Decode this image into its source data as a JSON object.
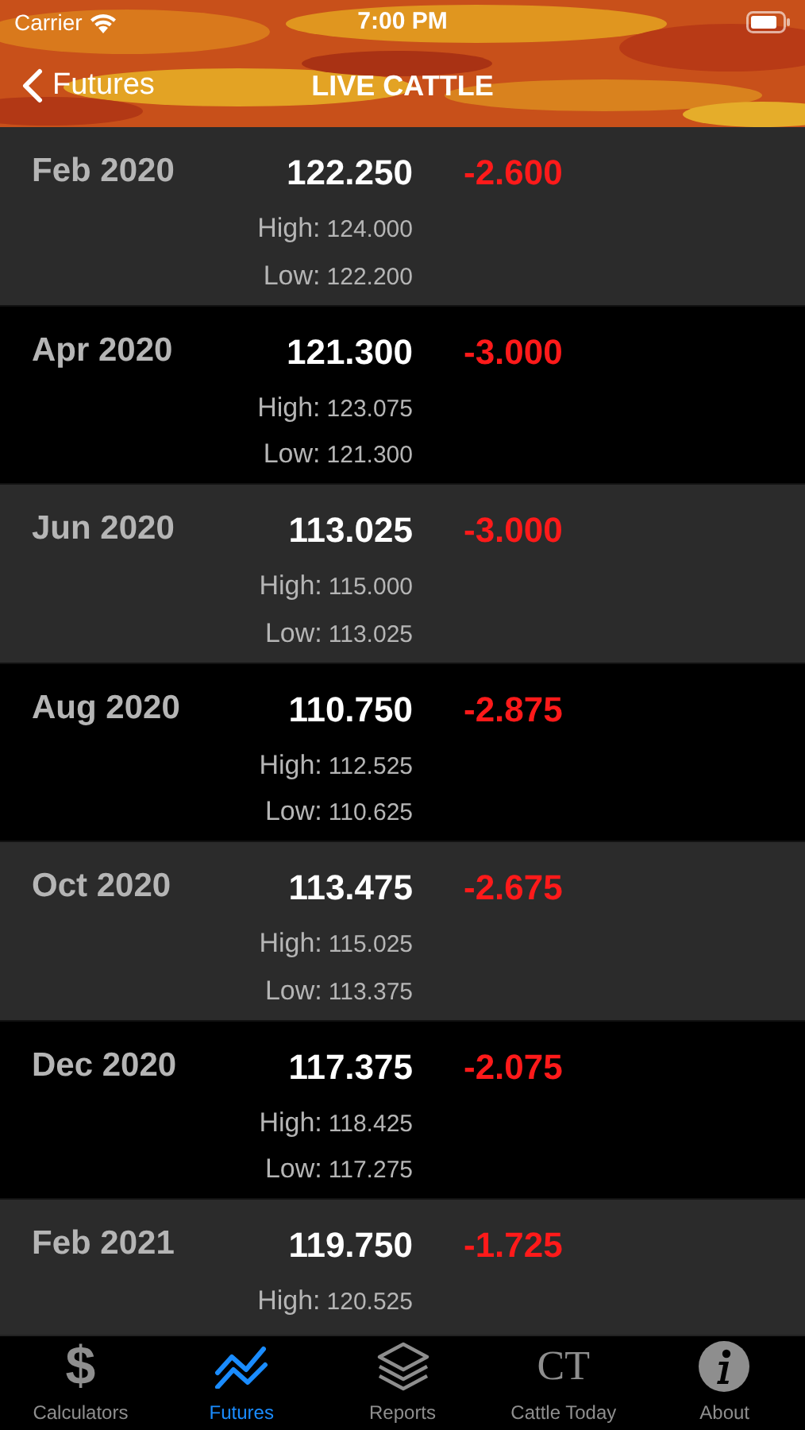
{
  "status_bar": {
    "carrier": "Carrier",
    "time": "7:00 PM"
  },
  "nav": {
    "back": "Futures",
    "title": "LIVE CATTLE"
  },
  "rows": [
    {
      "month": "Feb 2020",
      "price": "122.250",
      "change": "-2.600",
      "high_label": "High:",
      "high": "124.000",
      "low_label": "Low:",
      "low": "122.200"
    },
    {
      "month": "Apr 2020",
      "price": "121.300",
      "change": "-3.000",
      "high_label": "High:",
      "high": "123.075",
      "low_label": "Low:",
      "low": "121.300"
    },
    {
      "month": "Jun 2020",
      "price": "113.025",
      "change": "-3.000",
      "high_label": "High:",
      "high": "115.000",
      "low_label": "Low:",
      "low": "113.025"
    },
    {
      "month": "Aug 2020",
      "price": "110.750",
      "change": "-2.875",
      "high_label": "High:",
      "high": "112.525",
      "low_label": "Low:",
      "low": "110.625"
    },
    {
      "month": "Oct 2020",
      "price": "113.475",
      "change": "-2.675",
      "high_label": "High:",
      "high": "115.025",
      "low_label": "Low:",
      "low": "113.375"
    },
    {
      "month": "Dec 2020",
      "price": "117.375",
      "change": "-2.075",
      "high_label": "High:",
      "high": "118.425",
      "low_label": "Low:",
      "low": "117.275"
    },
    {
      "month": "Feb 2021",
      "price": "119.750",
      "change": "-1.725",
      "high_label": "High:",
      "high": "120.525"
    }
  ],
  "tabs": [
    {
      "label": "Calculators",
      "kind": "dollar",
      "glyph": "$",
      "selected": false
    },
    {
      "label": "Futures",
      "kind": "chart",
      "selected": true
    },
    {
      "label": "Reports",
      "kind": "layers",
      "selected": false
    },
    {
      "label": "Cattle Today",
      "kind": "monogram",
      "glyph": "CT",
      "selected": false
    },
    {
      "label": "About",
      "kind": "info",
      "selected": false
    }
  ]
}
